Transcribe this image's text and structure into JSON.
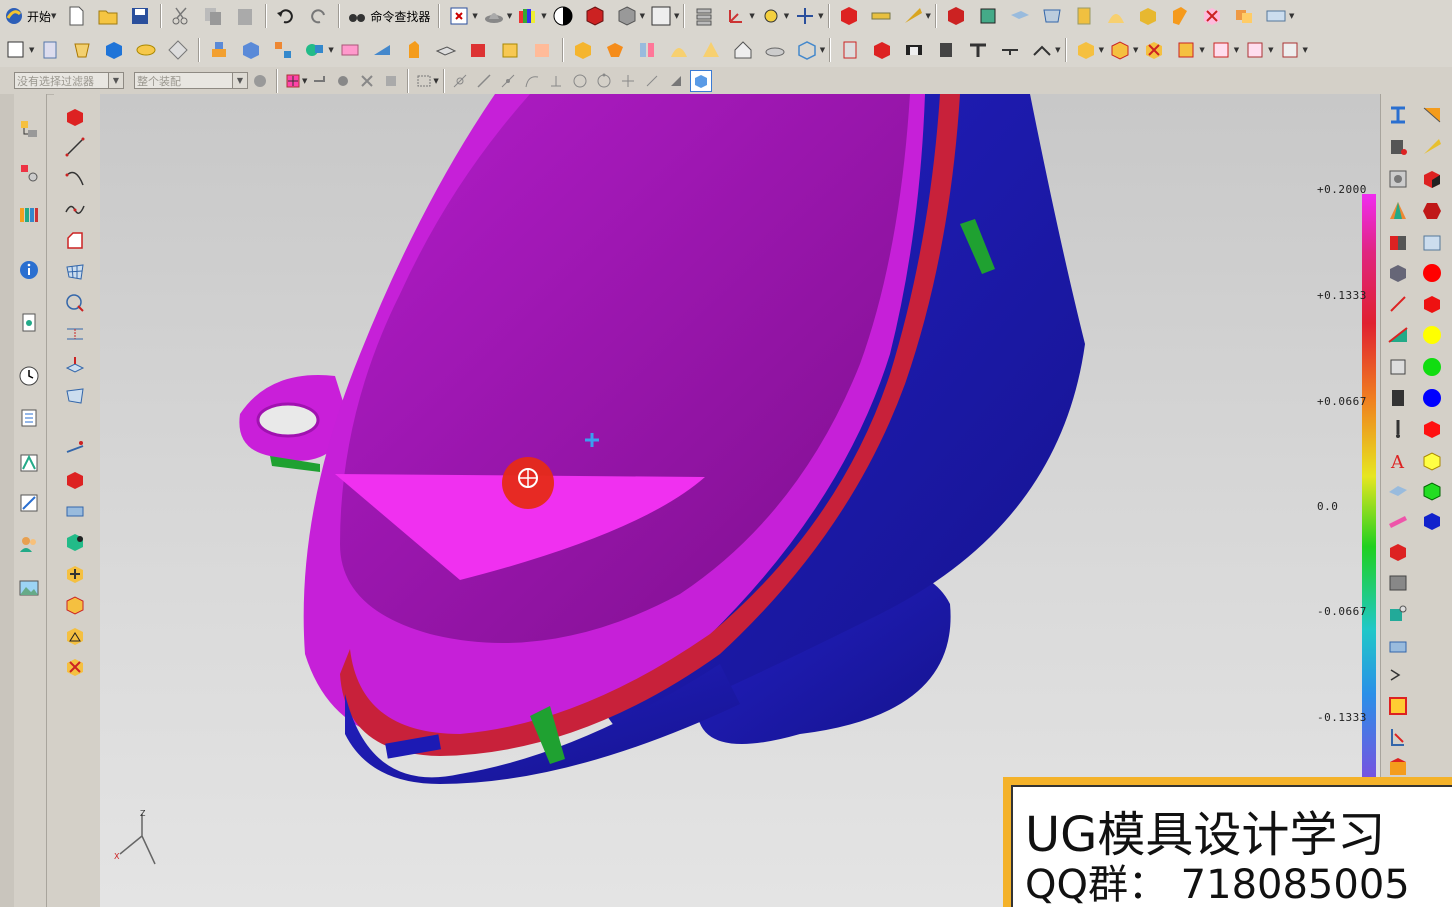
{
  "toolbar": {
    "start_label": "开始",
    "command_finder_label": "命令查找器"
  },
  "selection_bar": {
    "filter_value": "没有选择过滤器",
    "scope_value": "整个装配"
  },
  "viewport": {
    "background_color": "#d3d3d3",
    "part_colors": {
      "primary": "#c020d8",
      "secondary": "#1c1ab4",
      "accent_red": "#c8213a",
      "accent_green": "#1fa131"
    }
  },
  "deviation_scale": {
    "labels": [
      "+0.2000",
      "+0.1333",
      "+0.0667",
      "0.0",
      "-0.0667",
      "-0.1333"
    ]
  },
  "watermark": {
    "line1": "UG模具设计学习",
    "line2": "QQ群： 718085005"
  },
  "triad": {
    "x_label": "X",
    "z_label": "Z"
  }
}
